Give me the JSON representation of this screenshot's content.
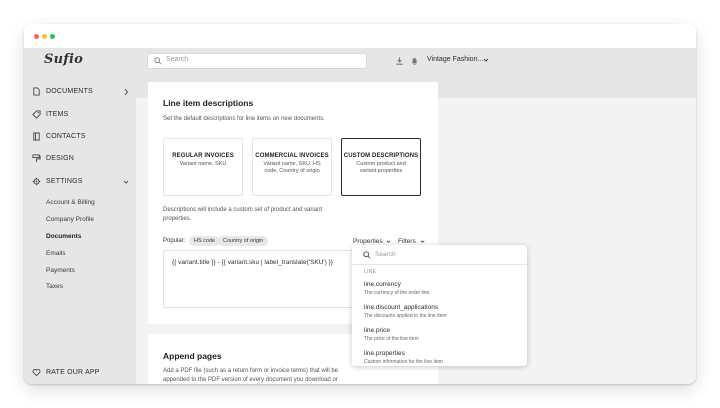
{
  "app": {
    "logo": "Sufio"
  },
  "topbar": {
    "search_placeholder": "Search",
    "download_icon": "download-icon",
    "notification_icon": "bell-icon",
    "store_name": "Vintage Fashion..."
  },
  "sidebar": {
    "items": [
      {
        "label": "DOCUMENTS",
        "icon": "document-icon"
      },
      {
        "label": "ITEMS",
        "icon": "tag-icon"
      },
      {
        "label": "CONTACTS",
        "icon": "address-book-icon"
      },
      {
        "label": "DESIGN",
        "icon": "paint-roller-icon"
      },
      {
        "label": "SETTINGS",
        "icon": "gear-icon"
      }
    ],
    "settings_sub": [
      {
        "label": "Account & Billing"
      },
      {
        "label": "Company Profile"
      },
      {
        "label": "Documents"
      },
      {
        "label": "Emails"
      },
      {
        "label": "Payments"
      },
      {
        "label": "Taxes"
      }
    ],
    "footer": {
      "label": "RATE OUR APP",
      "icon": "heart-icon"
    }
  },
  "line_items": {
    "title": "Line item descriptions",
    "subtitle": "Set the default descriptions for line items on new documents.",
    "cards": [
      {
        "title": "REGULAR INVOICES",
        "desc": "Variant name, SKU"
      },
      {
        "title": "COMMERCIAL INVOICES",
        "desc": "Variant name, SKU, HS code, Country of origin"
      },
      {
        "title": "CUSTOM DESCRIPTIONS",
        "desc": "Custom product and variant properties"
      }
    ],
    "selected_card": "CUSTOM DESCRIPTIONS",
    "note": "Descriptions will include a custom set of product and variant properties.",
    "popular_label": "Popular:",
    "chips": [
      "HS code",
      "Country of origin"
    ],
    "properties_label": "Properties",
    "filters_label": "Filters",
    "template": "{{ variant.title }} - {{ variant.sku | label_translate('SKU') }}"
  },
  "properties_popup": {
    "search_placeholder": "Search",
    "section": "LINE",
    "items": [
      {
        "name": "line.currency",
        "desc": "The currency of the order line."
      },
      {
        "name": "line.discount_applications",
        "desc": "The discounts applied to the line item"
      },
      {
        "name": "line.price",
        "desc": "The price of the line item"
      },
      {
        "name": "line.properties",
        "desc": "Custom information for the line item"
      }
    ]
  },
  "append_pages": {
    "title": "Append pages",
    "desc_line1": "Add a PDF file (such as a return form or invoice terms) that will be",
    "desc_line2": "appended to the PDF version of every document you download or"
  },
  "colors": {
    "sidebar_bg": "#e6e6e6",
    "selected_border": "#2b2b2b",
    "accent_text": "#2b2b2b"
  }
}
